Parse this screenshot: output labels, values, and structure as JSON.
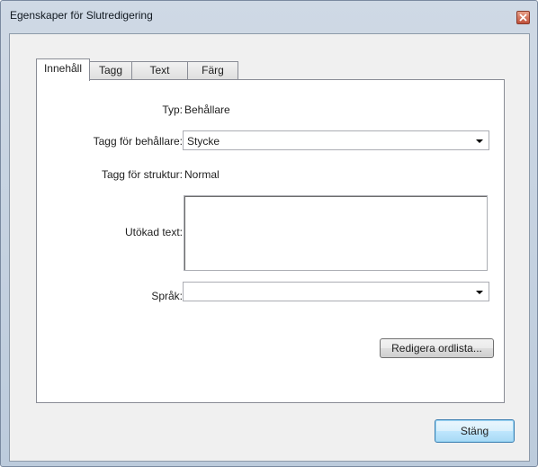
{
  "window": {
    "title": "Egenskaper för Slutredigering"
  },
  "tabs": [
    {
      "label": "Innehåll",
      "active": true
    },
    {
      "label": "Tagg",
      "active": false
    },
    {
      "label": "Text",
      "active": false
    },
    {
      "label": "Färg",
      "active": false
    }
  ],
  "content": {
    "type_label": "Typ:",
    "type_value": "Behållare",
    "container_tag_label": "Tagg för behållare:",
    "container_tag_value": "Stycke",
    "structure_tag_label": "Tagg för struktur:",
    "structure_tag_value": "Normal",
    "extended_text_label": "Utökad text:",
    "extended_text_value": "",
    "language_label": "Språk:",
    "language_value": "",
    "edit_dictionary_label": "Redigera ordlista..."
  },
  "footer": {
    "close_label": "Stäng"
  },
  "colors": {
    "window_frame": "#bccbdc",
    "default_button": "#bee6fd",
    "close_button": "#c0503a"
  },
  "icons": {
    "close": "close-x-icon",
    "dropdown": "chevron-down-icon"
  }
}
